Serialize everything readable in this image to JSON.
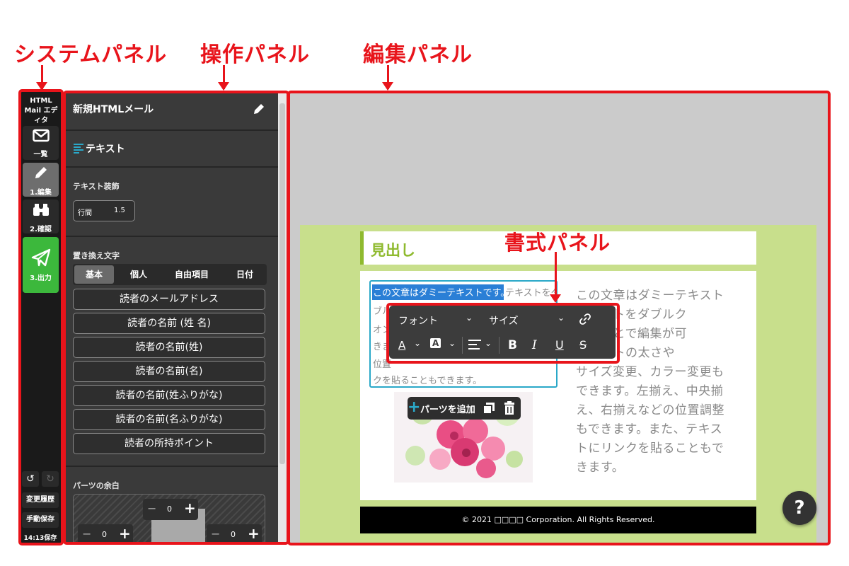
{
  "annotations": {
    "system_panel": "システムパネル",
    "operation_panel": "操作パネル",
    "edit_panel": "編集パネル",
    "format_panel": "書式パネル"
  },
  "system_panel": {
    "app_title": "HTML Mail エディタ",
    "buttons": [
      {
        "label": "一覧",
        "icon": "envelope-icon"
      },
      {
        "label": "1.編集",
        "icon": "pencil-icon"
      },
      {
        "label": "2.確認",
        "icon": "binoculars-icon"
      },
      {
        "label": "3.出力",
        "icon": "paper-plane-icon"
      }
    ],
    "undo_icon": "undo-icon",
    "redo_icon": "redo-icon",
    "history_label": "変更履歴",
    "manual_save_label": "手動保存",
    "autosave_status": "14:13保存"
  },
  "operation_panel": {
    "mail_title": "新規HTMLメール",
    "section_title": "テキスト",
    "text_decoration_label": "テキスト装飾",
    "line_height_label": "行間",
    "line_height_value": "1.5",
    "replace_label": "置き換え文字",
    "tabs": [
      "基本",
      "個人",
      "自由項目",
      "日付"
    ],
    "active_tab": "基本",
    "replace_buttons": [
      "読者のメールアドレス",
      "読者の名前 (姓 名)",
      "読者の名前(姓)",
      "読者の名前(名)",
      "読者の名前(姓ふりがな)",
      "読者の名前(名ふりがな)",
      "読者の所持ポイント"
    ],
    "margin_label": "パーツの余白",
    "margin_top": "0",
    "margin_left": "0",
    "margin_right": "0"
  },
  "edit_panel": {
    "heading": "見出し",
    "selected_text": "この文章はダミーテキストです。",
    "editing_text_rest": "テキストをダブルクリックすることで編集ができます。フォントの太さやサイズ変更、カラー変更もできます。左揃え、中央揃え、右揃えなどの位置調整もできます。また、テキストにリンクを貼ることもできます。",
    "editing_visible_lines": [
      "テキストをダ",
      "ブル",
      "オン",
      "きま",
      "位置",
      "クを貼ることもできます。"
    ],
    "right_text_lines": [
      "この文章はダミーテキスト",
      "テキストをダブルク",
      "することで編集が可",
      "フォントの太さや",
      "サイズ変更、カラー変更も",
      "できます。左揃え、中央揃",
      "え、右揃えなどの位置調整",
      "もできます。また、テキス",
      "トにリンクを貼ることもで",
      "きます。"
    ],
    "add_parts_label": "パーツを追加",
    "footer_text": "© 2021 □□□□ Corporation. All Rights Reserved.",
    "help_label": "?"
  },
  "format_toolbar": {
    "font_select": "フォント",
    "size_select": "サイズ",
    "bold": "B",
    "italic": "I",
    "underline": "U",
    "strike": "S"
  },
  "colors": {
    "accent_red": "#e8141b",
    "active_green": "#3cb83c",
    "mail_background": "#c8df8c",
    "heading_green": "#8fba2f",
    "selection_blue": "#2a7fd6"
  }
}
